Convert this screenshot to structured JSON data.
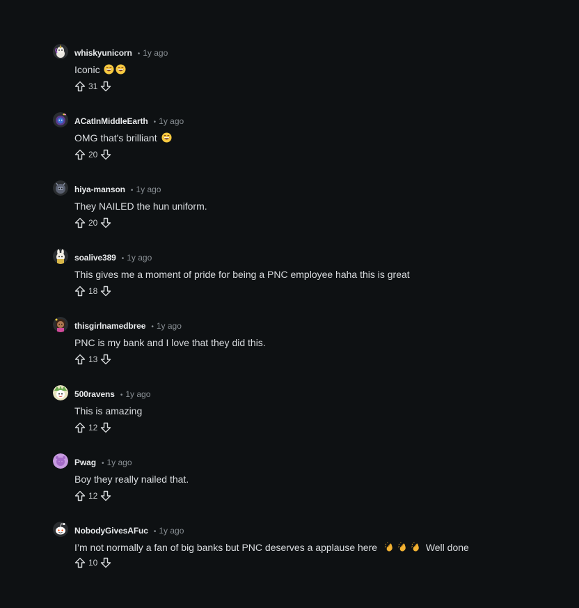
{
  "comments": [
    {
      "author": "whiskyunicorn",
      "time": "1y ago",
      "text": "Iconic",
      "emojis": [
        "grinning-sweat",
        "grinning-sweat"
      ],
      "score": "31",
      "avatar_color": "#c9c2b8",
      "avatar": "unicorn-avatar"
    },
    {
      "author": "ACatInMiddleEarth",
      "time": "1y ago",
      "text": "OMG that's brilliant",
      "emojis": [
        "grinning-sweat"
      ],
      "score": "20",
      "avatar_color": "#5b3a8c",
      "avatar": "cat-avatar"
    },
    {
      "author": "hiya-manson",
      "time": "1y ago",
      "text": "They NAILED the hun uniform.",
      "emojis": [],
      "score": "20",
      "avatar_color": "#5a6070",
      "avatar": "robot-avatar"
    },
    {
      "author": "soalive389",
      "time": "1y ago",
      "text": "This gives me a moment of pride for being a PNC employee haha this is great",
      "emojis": [],
      "score": "18",
      "avatar_color": "#d9c98a",
      "avatar": "bunny-avatar"
    },
    {
      "author": "thisgirlnamedbree",
      "time": "1y ago",
      "text": "PNC is my bank and I love that they did this.",
      "emojis": [],
      "score": "13",
      "avatar_color": "#8a5a3a",
      "avatar": "girl-avatar"
    },
    {
      "author": "500ravens",
      "time": "1y ago",
      "text": "This is amazing",
      "emojis": [],
      "score": "12",
      "avatar_color": "#e8e4c0",
      "avatar": "raven-avatar"
    },
    {
      "author": "Pwag",
      "time": "1y ago",
      "text": "Boy they really nailed that.",
      "emojis": [],
      "score": "12",
      "avatar_color": "#c79be0",
      "avatar": "default-avatar"
    },
    {
      "author": "NobodyGivesAFuc",
      "time": "1y ago",
      "text": "I’m not normally a fan of big banks but PNC deserves a applause here",
      "emojis": [
        "clap",
        "clap",
        "clap"
      ],
      "text_after": "Well done",
      "score": "10",
      "avatar_color": "#ffffff",
      "avatar": "snoo-avatar"
    }
  ],
  "separator": "•"
}
